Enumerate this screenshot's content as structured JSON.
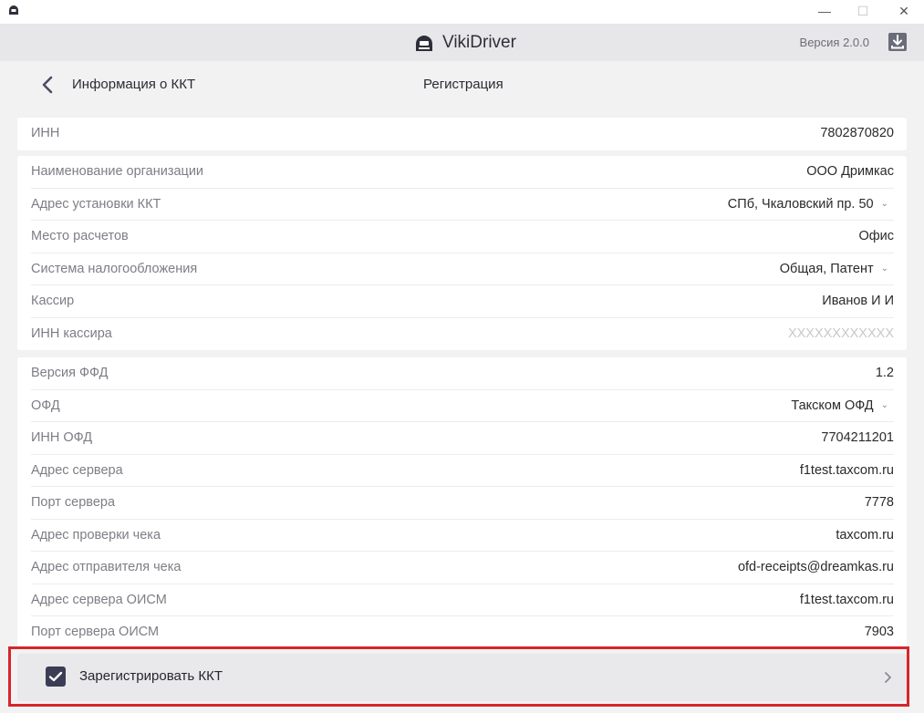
{
  "window": {
    "minimize_glyph": "—",
    "maximize_glyph": "☐",
    "close_glyph": "✕"
  },
  "header": {
    "app_name": "VikiDriver",
    "version": "Версия 2.0.0",
    "icons": {
      "brand": "printer-icon",
      "download": "download-icon"
    }
  },
  "subheader": {
    "title": "Информация о ККТ",
    "center": "Регистрация"
  },
  "cards": {
    "inn": {
      "rows": [
        {
          "label": "ИНН",
          "value": "7802870820"
        }
      ]
    },
    "org": {
      "rows": [
        {
          "label": "Наименование организации",
          "value": "ООО Дримкас",
          "dropdown": false
        },
        {
          "label": "Адрес установки ККТ",
          "value": "СПб, Чкаловский пр. 50",
          "dropdown": true
        },
        {
          "label": "Место расчетов",
          "value": "Офис",
          "dropdown": false
        },
        {
          "label": "Система налогообложения",
          "value": "Общая, Патент",
          "dropdown": true
        },
        {
          "label": "Кассир",
          "value": "Иванов И И",
          "dropdown": false
        },
        {
          "label": "ИНН кассира",
          "value": "XXXXXXXXXXXX",
          "placeholder": true
        }
      ]
    },
    "ofd": {
      "rows": [
        {
          "label": "Версия ФФД",
          "value": "1.2"
        },
        {
          "label": "ОФД",
          "value": "Такском ОФД",
          "dropdown": true
        },
        {
          "label": "ИНН ОФД",
          "value": "7704211201"
        },
        {
          "label": "Адрес сервера",
          "value": "f1test.taxcom.ru"
        },
        {
          "label": "Порт сервера",
          "value": "7778"
        },
        {
          "label": "Адрес проверки чека",
          "value": "taxcom.ru"
        },
        {
          "label": "Адрес отправителя чека",
          "value": "ofd-receipts@dreamkas.ru"
        },
        {
          "label": "Адрес сервера ОИСМ",
          "value": "f1test.taxcom.ru"
        },
        {
          "label": "Порт сервера ОИСМ",
          "value": "7903"
        }
      ]
    }
  },
  "register": {
    "label": "Зарегистрировать ККТ",
    "checked": true
  },
  "colors": {
    "accent": "#3b3d55",
    "highlight": "#d6262b",
    "header_bg": "#e7e7e9"
  }
}
